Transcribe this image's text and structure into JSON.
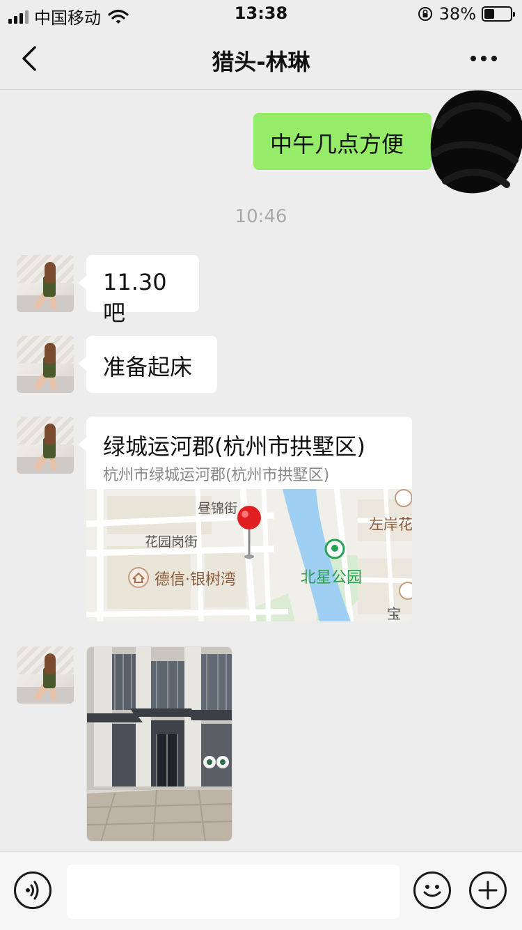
{
  "status_bar": {
    "carrier": "中国移动",
    "time": "13:38",
    "battery_percent": "38%",
    "battery_level": 0.38
  },
  "header": {
    "title": "猎头-林琳",
    "back_icon": "chevron-left-icon",
    "more_icon": "more-dots-icon"
  },
  "messages": [
    {
      "direction": "outgoing",
      "type": "text",
      "text": "中午几点方便"
    },
    {
      "type": "timestamp",
      "text": "10:46"
    },
    {
      "direction": "incoming",
      "type": "text",
      "text": "11.30吧"
    },
    {
      "direction": "incoming",
      "type": "text",
      "text": "准备起床"
    },
    {
      "direction": "incoming",
      "type": "location",
      "title": "绿城运河郡(杭州市拱墅区)",
      "address": "杭州市绿城运河郡(杭州市拱墅区)",
      "map_labels": [
        "昼锦街",
        "花园岗街",
        "德信·银树湾",
        "北星公园",
        "左岸花",
        "宝"
      ]
    },
    {
      "direction": "incoming",
      "type": "image",
      "alt": "building-entrance-photo"
    }
  ],
  "input_bar": {
    "voice_icon": "voice-icon",
    "emoji_icon": "emoji-icon",
    "plus_icon": "plus-icon",
    "placeholder": ""
  }
}
